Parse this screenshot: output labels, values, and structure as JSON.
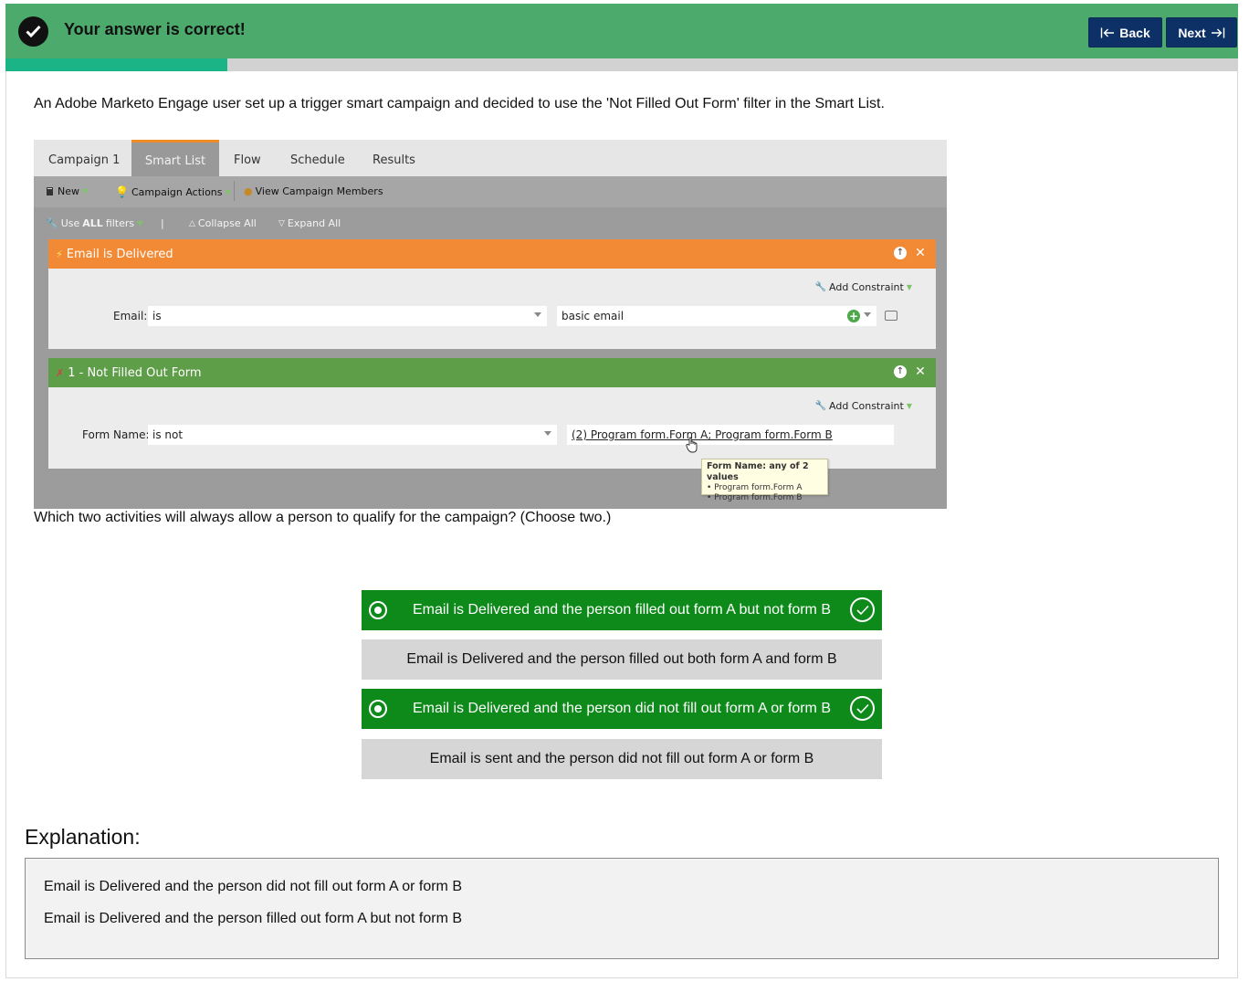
{
  "header": {
    "title": "Your answer is correct!",
    "back_label": "Back",
    "next_label": "Next",
    "bg_color": "#4caa6c"
  },
  "progress": {
    "fraction": 0.18,
    "color": "#1bb486"
  },
  "question": {
    "intro": "An Adobe Marketo Engage user set up a trigger smart campaign and decided to use the 'Not Filled Out Form' filter in the Smart List.",
    "prompt": "Which two activities will always allow a person to qualify for the campaign? (Choose two.)"
  },
  "marketo": {
    "tabs": [
      "Campaign 1",
      "Smart List",
      "Flow",
      "Schedule",
      "Results"
    ],
    "active_tab": "Smart List",
    "toolbar": {
      "new": "New",
      "campaign_actions": "Campaign Actions",
      "view_members": "View Campaign Members"
    },
    "filterbar": {
      "use_all_prefix": "Use",
      "use_all_bold": "ALL",
      "use_all_suffix": "filters",
      "separator": "|",
      "collapse_all": "Collapse All",
      "expand_all": "Expand All"
    },
    "trigger": {
      "title": "Email is Delivered",
      "add_constraint": "Add Constraint",
      "label": "Email:",
      "operator": "is",
      "value": "basic email"
    },
    "filter": {
      "title": "1 - Not Filled Out Form",
      "add_constraint": "Add Constraint",
      "label": "Form Name:",
      "operator": "is not",
      "value": "(2) Program form.Form A; Program form.Form B"
    },
    "tooltip": {
      "title": "Form Name: any of 2 values",
      "items": [
        "Program form.Form A",
        "Program form.Form B"
      ]
    }
  },
  "answers": [
    {
      "text": "Email is Delivered and the person filled out form A but not form B",
      "correct": true
    },
    {
      "text": "Email is Delivered and the person filled out both form A and form B",
      "correct": false
    },
    {
      "text": "Email is Delivered and the person did not fill out form A or form B",
      "correct": true
    },
    {
      "text": "Email is sent and the person did not fill out form A or form B",
      "correct": false
    }
  ],
  "explanation": {
    "title": "Explanation:",
    "lines": [
      "Email is Delivered and the person did not fill out form A or form B",
      "Email is Delivered and the person filled out form A but not form B"
    ]
  }
}
